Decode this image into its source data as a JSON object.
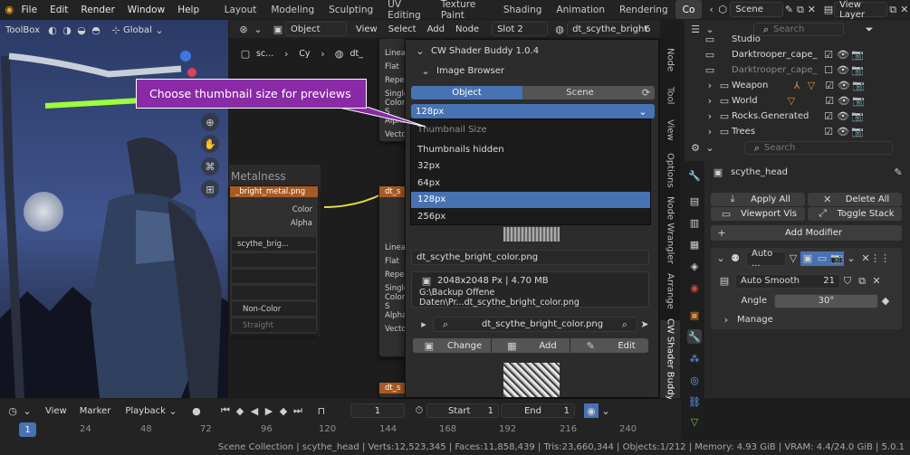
{
  "menu": [
    "File",
    "Edit",
    "Render",
    "Window",
    "Help"
  ],
  "workspaces": [
    "Layout",
    "Modeling",
    "Sculpting",
    "UV Editing",
    "Texture Paint",
    "Shading",
    "Animation",
    "Rendering",
    "Co"
  ],
  "scene": "Scene",
  "view_layer": "View Layer",
  "viewport": {
    "toolbox": "ToolBox",
    "orientation": "Global"
  },
  "node_header": {
    "object_mode": "Object",
    "menus": [
      "View",
      "Select",
      "Add",
      "Node"
    ],
    "slot": "Slot 2",
    "material": "dt_scythe_bright",
    "users": "6",
    "breadcrumb": [
      "sc...",
      "Cy",
      "dt_"
    ]
  },
  "nodes": {
    "top_rows": [
      "Linear",
      "Flat",
      "Repeat",
      "Single",
      "Color S",
      "Alpha",
      "Vector"
    ],
    "metalness_title": "Metalness",
    "metal_image": "_bright_metal.png",
    "outputs": [
      "Color",
      "Alpha"
    ],
    "image_field": "scythe_brig...",
    "colorspace": "Non-Color",
    "alpha_mode": "Straight",
    "right_rows": [
      "Linear",
      "Flat",
      "Repeat",
      "Single",
      "Color S",
      "Alpha",
      "Vector"
    ],
    "right_tag": "dt_s",
    "bottom_tag": "dt_s"
  },
  "addon": {
    "title": "CW Shader Buddy 1.0.4",
    "panel": "Image Browser",
    "tabs": [
      "Object",
      "Scene"
    ],
    "size_value": "128px",
    "dropdown_title": "Thumbnail Size",
    "options": [
      "Thumbnails hidden",
      "32px",
      "64px",
      "128px",
      "256px"
    ],
    "selected_option": "128px",
    "image_name": "dt_scythe_bright_color.png",
    "image_info": "2048x2048 Px | 4.70 MB",
    "image_path": "G:\\Backup Offene Daten\\Pr...dt_scythe_bright_color.png",
    "search_value": "dt_scythe_bright_color.png",
    "buttons": [
      "Change",
      "Add",
      "Edit"
    ]
  },
  "side_tabs": [
    "Node",
    "Tool",
    "View",
    "Options",
    "Node Wrangler",
    "Arrange",
    "CW Shader Buddy"
  ],
  "callout": "Choose thumbnail size for previews",
  "outliner": {
    "search_placeholder": "Search",
    "items": [
      "Studio",
      "Darktrooper_cape_c",
      "Darktrooper_cape_",
      "Weapon",
      "World",
      "Rocks.Generated",
      "Trees"
    ]
  },
  "properties": {
    "search_placeholder": "Search",
    "object": "scythe_head",
    "apply_all": "Apply All",
    "delete_all": "Delete All",
    "viewport_vis": "Viewport Vis",
    "toggle_stack": "Toggle Stack",
    "add_modifier": "Add Modifier",
    "modifier_short": "Auto ...",
    "node_group": "Auto Smooth",
    "node_users": "21",
    "angle_label": "Angle",
    "angle_value": "30°",
    "manage": "Manage"
  },
  "timeline": {
    "menus": [
      "View",
      "Marker",
      "Playback"
    ],
    "current_frame": "1",
    "start_label": "Start",
    "start": "1",
    "end_label": "End",
    "end": "1",
    "frames": [
      "1",
      "24",
      "48",
      "72",
      "96",
      "120",
      "144",
      "168",
      "192",
      "216",
      "240"
    ]
  },
  "status": "Scene Collection | scythe_head | Verts:12,523,345 | Faces:11,858,439 | Tris:23,660,344 | Objects:1/212 | Memory: 4.93 GiB | VRAM: 4.4/24.0 GiB | 5.0.1",
  "colors": {
    "accent": "#4772b3",
    "callout": "#8a2aa6",
    "link": "#e8d84a",
    "node_header": "#a85a23"
  }
}
